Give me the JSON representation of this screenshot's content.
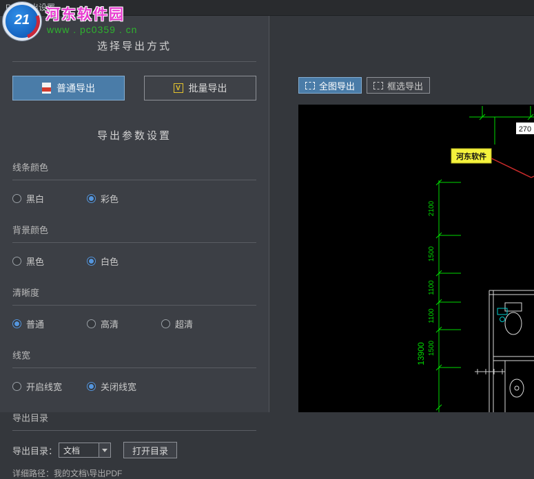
{
  "window": {
    "title": "PDF导出设置"
  },
  "watermark": {
    "badge": "21",
    "site": "河东软件园",
    "url": "www . pc0359 . cn"
  },
  "export_mode": {
    "title": "选择导出方式",
    "normal": "普通导出",
    "batch": "批量导出",
    "batch_icon_letter": "V"
  },
  "params": {
    "title": "导出参数设置",
    "line_color": {
      "label": "线条颜色",
      "options": [
        "黑白",
        "彩色"
      ],
      "selected": "彩色"
    },
    "bg_color": {
      "label": "背景颜色",
      "options": [
        "黑色",
        "白色"
      ],
      "selected": "白色"
    },
    "clarity": {
      "label": "清晰度",
      "options": [
        "普通",
        "高清",
        "超清"
      ],
      "selected": "普通"
    },
    "line_width": {
      "label": "线宽",
      "options": [
        "开启线宽",
        "关闭线宽"
      ],
      "selected": "关闭线宽"
    }
  },
  "export_dir": {
    "title": "导出目录",
    "label": "导出目录：",
    "value": "文档",
    "open_button": "打开目录",
    "detail": "详细路径：我的文档\\导出PDF"
  },
  "preview": {
    "tabs": [
      {
        "label": "全图导出",
        "selected": true
      },
      {
        "label": "框选导出",
        "selected": false
      }
    ],
    "drawing": {
      "top_dim": "270",
      "vertical_dims": [
        "2100",
        "1500",
        "1100",
        "1100",
        "1500"
      ],
      "total_dim": "13900",
      "highlight_label": "河东软件"
    }
  },
  "colors": {
    "accent_blue": "#4a7ca8",
    "dimension_green": "#00dd00",
    "highlight_yellow": "#f5f23c",
    "leader_red": "#cc2b2b",
    "panel_bg": "#3c3f45",
    "preview_bg": "#000000"
  }
}
